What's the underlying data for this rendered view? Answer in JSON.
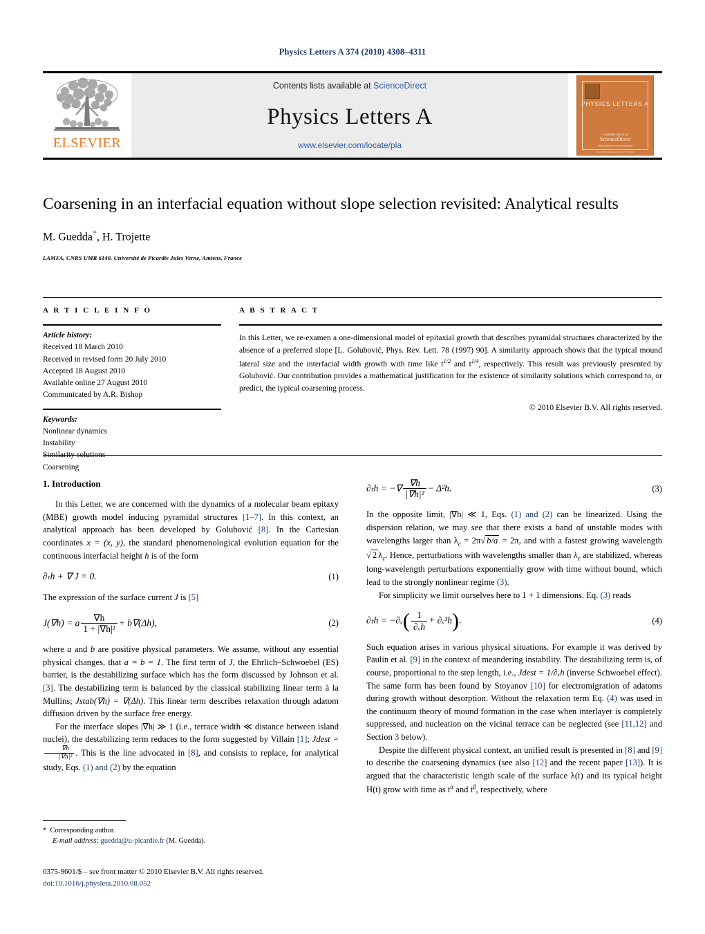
{
  "running_head": "Physics Letters A 374 (2010) 4308–4311",
  "masthead": {
    "contents_prefix": "Contents lists available at ",
    "sciencedirect": "ScienceDirect",
    "journal_title": "Physics Letters A",
    "journal_url": "www.elsevier.com/locate/pla",
    "elsevier_wordmark": "ELSEVIER",
    "cover": {
      "title": "PHYSICS LETTERS A",
      "foot1": "Available online at",
      "foot2": "ScienceDirect",
      "foot3": "www.elsevier.com/locate/pla",
      "foot4": "An International Journal of Physics"
    },
    "accent_orange": "#E87722",
    "link_blue": "#2d5fb0",
    "band_gray": "#ececec"
  },
  "title": "Coarsening in an interfacial equation without slope selection revisited: Analytical results",
  "authors": "M. Guedda",
  "authors_rest": ", H. Trojette",
  "affiliation": "LAMFA, CNRS UMR 6140, Université de Picardie Jules Verne, Amiens, France",
  "article_info": {
    "heading": "A R T I C L E   I N F O",
    "history_label": "Article history:",
    "history": [
      "Received 18 March 2010",
      "Received in revised form 20 July 2010",
      "Accepted 18 August 2010",
      "Available online 27 August 2010",
      "Communicated by A.R. Bishop"
    ],
    "keywords_label": "Keywords:",
    "keywords": [
      "Nonlinear dynamics",
      "Instability",
      "Similarity solutions",
      "Coarsening"
    ]
  },
  "abstract": {
    "heading": "A B S T R A C T",
    "text": "In this Letter, we re-examen a one-dimensional model of epitaxial growth that describes pyramidal structures characterized by the absence of a preferred slope [L. Golubović, Phys. Rev. Lett. 78 (1997) 90]. A similarity approach shows that the typical mound lateral size and the interfacial width growth with time like t",
    "exp1": "1/2",
    "text_mid": " and t",
    "exp2": "1/4",
    "text_end": ", respectively. This result was previously presented by Golubović. Our contribution provides a mathematical justification for the existence of similarity solutions which correspond to, or predict, the typical coarsening process.",
    "copyright": "© 2010 Elsevier B.V. All rights reserved."
  },
  "left_column": {
    "section_heading": "1. Introduction",
    "p1_a": "In this Letter, we are concerned with the dynamics of a molecular beam epitaxy (MBE) growth model inducing pyramidal structures ",
    "p1_ref1": "[1–7]",
    "p1_b": ". In this context, an analytical approach has been developed by Golubović ",
    "p1_ref2": "[8]",
    "p1_c": ". In the Cartesian coordinates ",
    "p1_math": "x = (x, y)",
    "p1_d": ", the standard phenomenological evolution equation for the continuous interfacial height ",
    "p1_h": "h",
    "p1_e": " is of the form",
    "eq1": "∂ₜh + ∇ J = 0.",
    "eq1_num": "(1)",
    "p2_a": "The expression of the surface current ",
    "p2_J": "J",
    "p2_b": " is ",
    "p2_ref": "[5]",
    "eq2_lhs": "J(∇h) = a",
    "eq2_num_frac": "∇h",
    "eq2_den_frac": "1 + |∇h|²",
    "eq2_rhs": "+ b∇(Δh),",
    "eq2_num": "(2)",
    "p3_a": "where ",
    "p3_a_it": "a",
    "p3_b": " and ",
    "p3_b_it": "b",
    "p3_c": " are positive physical parameters. We assume, without any essential physical changes, that ",
    "p3_abeq": "a = b = 1",
    "p3_d": ". The first term of ",
    "p3_J": "J",
    "p3_e": ", the Ehrlich–Schwoebel (ES) barrier, is the destabilizing surface which has the form discussed by Johnson et al. ",
    "p3_ref3": "[3]",
    "p3_f": ". The destabilizing term is balanced by the classical stabilizing linear term à la Mullins; ",
    "p3_jstab": "Jstab(∇h) = ∇(Δh)",
    "p3_g": ". This linear term describes relaxation through adatom diffusion driven by the surface free energy.",
    "p4_a": "For the interface slopes |∇h| ≫ 1 (i.e., terrace width ≪ distance between island nuclei), the destabilizing term reduces to the form suggested by Villain ",
    "p4_ref1": "[1]",
    "p4_b": "; ",
    "p4_jdest": "Jdest =",
    "p4_frac_num": "∇h",
    "p4_frac_den": "|∇h|²",
    "p4_c": ". This is the line advocated in ",
    "p4_ref8": "[8]",
    "p4_d": ", and consists to replace, for analytical study, Eqs. ",
    "p4_ref12": "(1) and (2)",
    "p4_e": " by the equation"
  },
  "right_column": {
    "eq3_lhs": "∂ₜh = −∇",
    "eq3_num_frac": "∇h",
    "eq3_den_frac": "|∇h|²",
    "eq3_rhs": "− Δ²h.",
    "eq3_num": "(3)",
    "p1_a": "In the opposite limit, |∇h| ≪ 1, Eqs. ",
    "p1_ref": "(1) and (2)",
    "p1_b": " can be linearized. Using the dispersion relation, we may see that there exists a band of unstable modes with wavelengths larger than λ",
    "p1_sub_c": "c",
    "p1_c": " = 2π",
    "p1_sqrt": "b/a",
    "p1_d": " = 2π, and with a fastest growing wavelength ",
    "p1_sqrt2": "2",
    "p1_e": "λ",
    "p1_f": ". Hence, perturbations with wavelengths smaller than λ",
    "p1_g": " are stabilized, whereas long-wavelength perturbations exponentially grow with time without bound, which lead to the strongly nonlinear regime ",
    "p1_ref3": "(3)",
    "p1_h": ".",
    "p2_a": "For simplicity we limit ourselves here to 1 + 1 dimensions. Eq. ",
    "p2_ref3": "(3)",
    "p2_b": " reads",
    "eq4_lhs": "∂ₜh = −∂ₓ",
    "eq4_frac_num": "1",
    "eq4_frac_den": "∂ₓh",
    "eq4_rhs": "+ ∂ₓ³h",
    "eq4_tail": ".",
    "eq4_num": "(4)",
    "p3_a": "Such equation arises in various physical situations. For example it was derived by Paulin et al. ",
    "p3_ref9": "[9]",
    "p3_b": " in the context of meandering instability. The destabilizing term is, of course, proportional to the step length, i.e., ",
    "p3_jdest": "Jdest = 1/∂ₓh",
    "p3_c": " (inverse Schwoebel effect). The same form has been found by Stoyanov ",
    "p3_ref10": "[10]",
    "p3_d": " for electromigration of adatoms during growth without desorption. Without the relaxation term Eq. ",
    "p3_ref4": "(4)",
    "p3_e": " was used in the continuum theory of mound formation in the case when interlayer is completely suppressed, and nucleation on the vicinal terrace can be neglected (see ",
    "p3_ref1112": "[11,12]",
    "p3_f": " and Section ",
    "p3_ref_s3": "3",
    "p3_g": " below).",
    "p4_a": "Despite the different physical context, an unified result is presented in ",
    "p4_ref8": "[8]",
    "p4_b": " and ",
    "p4_ref9": "[9]",
    "p4_c": " to describe the coarsening dynamics (see also ",
    "p4_ref12": "[12]",
    "p4_d": " and the recent paper ",
    "p4_ref13": "[13]",
    "p4_e": "). It is argued that the characteristic length scale of the surface λ(t) and its typical height H(t) grow with time as t",
    "p4_alpha": "α",
    "p4_f": " and t",
    "p4_beta": "β",
    "p4_g": ", respectively, where"
  },
  "footnote": {
    "star": "*",
    "corresponding": "Corresponding author.",
    "email_label": "E-mail address:",
    "email": "guedda@u-picardie.fr",
    "email_owner": " (M. Guedda).",
    "issn_line": "0375-9601/$ – see front matter © 2010 Elsevier B.V. All rights reserved.",
    "doi": "doi:10.1016/j.physleta.2010.08.052"
  }
}
